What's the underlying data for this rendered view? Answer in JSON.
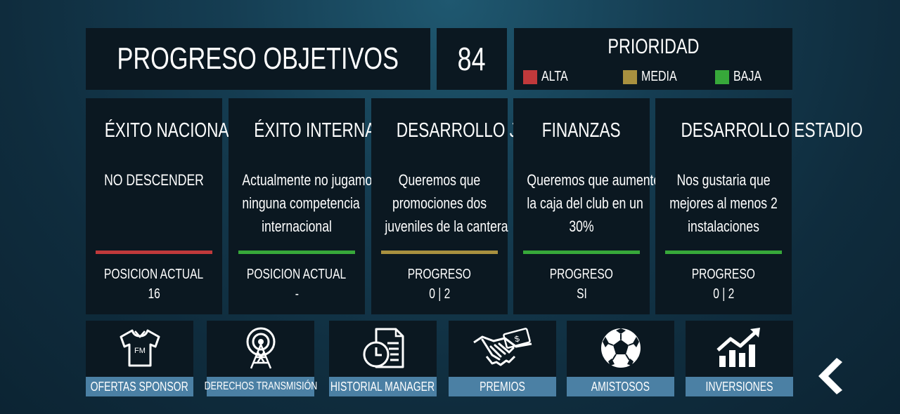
{
  "header": {
    "title": "PROGRESO OBJETIVOS",
    "score": "84",
    "priority": {
      "title": "PRIORIDAD",
      "levels": [
        {
          "label": "ALTA",
          "color": "#c0393b"
        },
        {
          "label": "MEDIA",
          "color": "#a8903f"
        },
        {
          "label": "BAJA",
          "color": "#37a83a"
        }
      ]
    }
  },
  "objectives": [
    {
      "title": "ÉXITO NACIONAL",
      "desc": [
        "NO DESCENDER"
      ],
      "priority": "ALTA",
      "bar_color": "#c0393b",
      "label": "POSICION ACTUAL",
      "value": "16"
    },
    {
      "title": "ÉXITO INTERNACIONAL",
      "desc": [
        "Actualmente no jugamos",
        "ninguna competencia",
        "internacional"
      ],
      "priority": "BAJA",
      "bar_color": "#37a83a",
      "label": "POSICION ACTUAL",
      "value": "-"
    },
    {
      "title": "DESARROLLO JUVENIL",
      "desc": [
        "Queremos que",
        "promociones dos",
        "juveniles de la cantera"
      ],
      "priority": "MEDIA",
      "bar_color": "#a8903f",
      "label": "PROGRESO",
      "value": "0 | 2"
    },
    {
      "title": "FINANZAS",
      "desc": [
        "Queremos que aumentes",
        "la caja del club en un",
        "30%"
      ],
      "priority": "BAJA",
      "bar_color": "#37a83a",
      "label": "PROGRESO",
      "value": "SI"
    },
    {
      "title": "DESARROLLO ESTADIO",
      "desc": [
        "Nos gustaria que",
        "mejores al menos 2",
        "instalaciones"
      ],
      "priority": "BAJA",
      "bar_color": "#37a83a",
      "label": "PROGRESO",
      "value": "0 | 2"
    }
  ],
  "buttons": [
    {
      "label": "OFERTAS SPONSOR",
      "icon": "jersey-icon",
      "badge": "FM"
    },
    {
      "label": "DERECHOS TRANSMISIÓN",
      "icon": "broadcast-tower-icon"
    },
    {
      "label": "HISTORIAL MANAGER",
      "icon": "document-clock-icon"
    },
    {
      "label": "PREMIOS",
      "icon": "handshake-money-icon"
    },
    {
      "label": "AMISTOSOS",
      "icon": "soccer-ball-icon"
    },
    {
      "label": "INVERSIONES",
      "icon": "growth-chart-icon"
    }
  ],
  "nav": {
    "back_icon": "chevron-left-icon"
  }
}
